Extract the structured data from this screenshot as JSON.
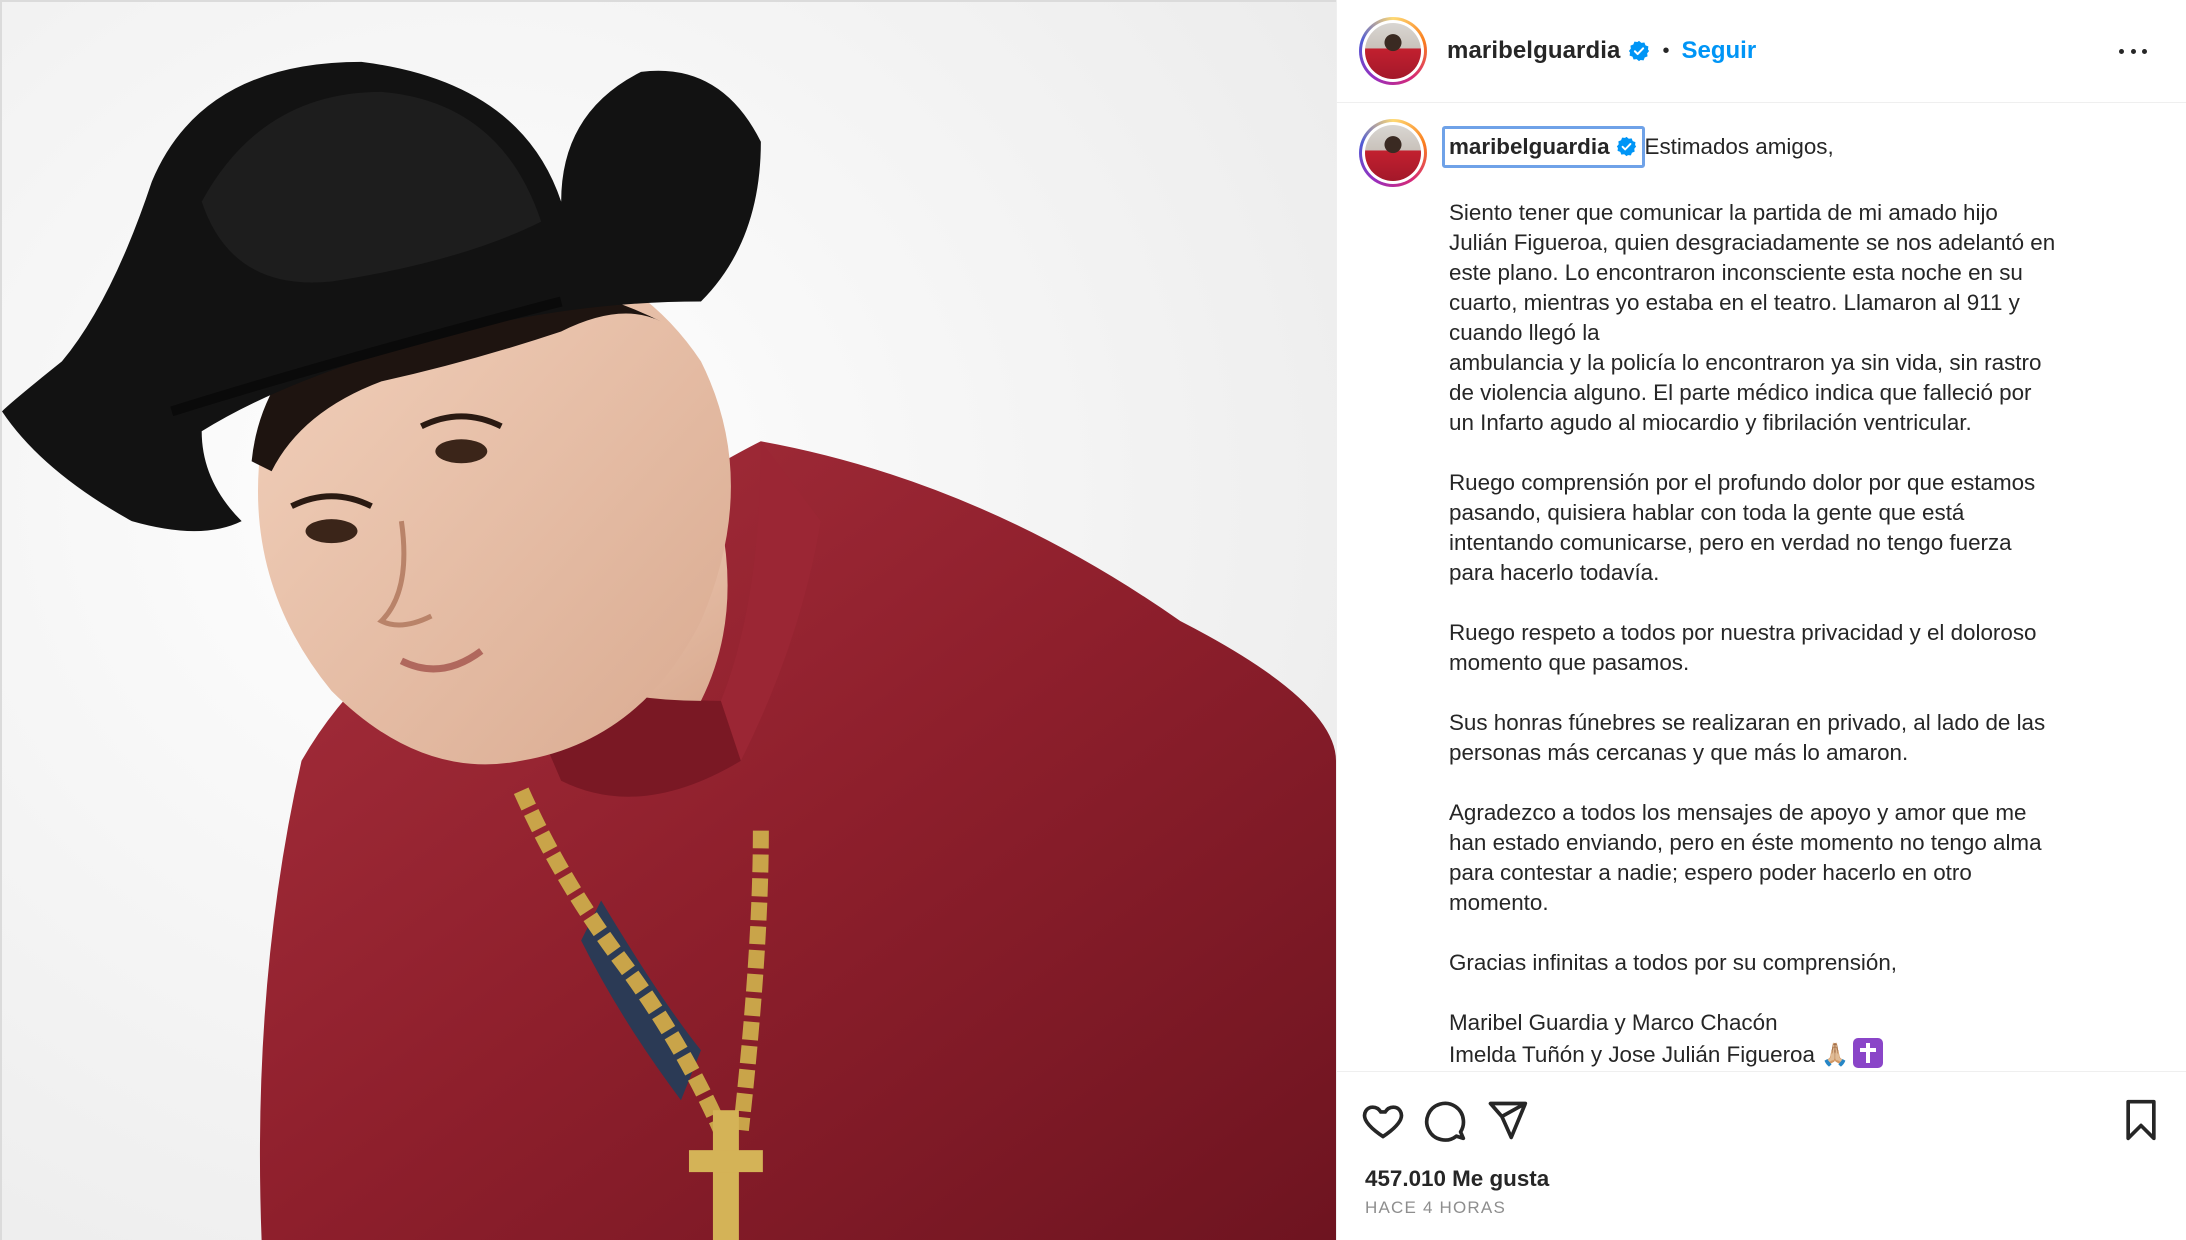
{
  "post": {
    "username": "maribelguardia",
    "follow_label": "Seguir",
    "separator": "•",
    "verified_icon": "verified-badge-icon",
    "more_icon": "more-options-icon"
  },
  "caption": {
    "username": "maribelguardia",
    "first_line": "Estimados amigos,",
    "lines": [
      "",
      "Siento tener que comunicar la partida de mi amado hijo",
      "Julián Figueroa, quien desgraciadamente se nos adelantó en",
      "este plano. Lo encontraron inconsciente esta noche en su",
      "cuarto, mientras yo estaba en el teatro. Llamaron al 911 y",
      "cuando llegó la",
      "ambulancia y la policía lo encontraron ya sin vida, sin rastro",
      "de violencia alguno. El parte médico indica que falleció por",
      "un Infarto agudo al miocardio y fibrilación ventricular.",
      "",
      "Ruego comprensión por el profundo dolor por que estamos",
      "pasando, quisiera hablar con toda la gente que está",
      "intentando comunicarse, pero en verdad no tengo fuerza",
      "para hacerlo todavía.",
      "",
      "Ruego respeto a todos por nuestra privacidad y el doloroso",
      "momento que pasamos.",
      "",
      "Sus honras fúnebres se realizaran en privado, al lado de las",
      "personas más cercanas y que más lo amaron.",
      "",
      "Agradezco a todos los mensajes de apoyo y amor que me",
      "han estado enviando, pero en éste momento no tengo alma",
      "para contestar a nadie; espero poder hacerlo en otro",
      "momento.",
      "",
      "Gracias infinitas a todos por su comprensión,",
      "",
      "Maribel Guardia y Marco Chacón"
    ],
    "last_line": "Imelda Tuñón y Jose Julián Figueroa",
    "emoji_pray": "🙏🏼"
  },
  "actions": {
    "like_icon": "heart-icon",
    "comment_icon": "comment-icon",
    "share_icon": "share-icon",
    "save_icon": "bookmark-icon",
    "likes_text": "457.010 Me gusta",
    "timestamp": "HACE 4 HORAS"
  },
  "colors": {
    "accent": "#0095f6",
    "text": "#262626",
    "muted": "#8e8e8e",
    "shirt": "#8e1f2c",
    "hat": "#121212"
  }
}
